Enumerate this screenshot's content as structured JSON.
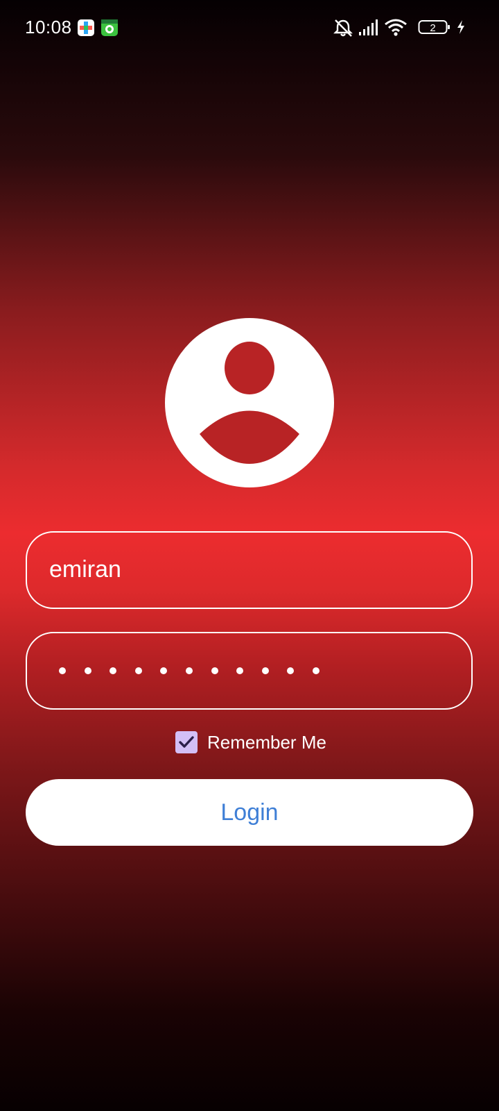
{
  "status_bar": {
    "time": "10:08",
    "battery_level": "2",
    "icons": [
      "notification-app-icon",
      "notification-shield-icon",
      "vibrate-off-icon",
      "signal-icon",
      "wifi-icon",
      "battery-icon",
      "charging-icon"
    ]
  },
  "login": {
    "username_value": "emiran",
    "password_length": 11,
    "remember_label": "Remember Me",
    "remember_checked": true,
    "button_label": "Login"
  },
  "colors": {
    "accent_red": "#ec2c2f",
    "checkbox_fill": "#d3bff6",
    "button_text": "#3f7fd6"
  }
}
